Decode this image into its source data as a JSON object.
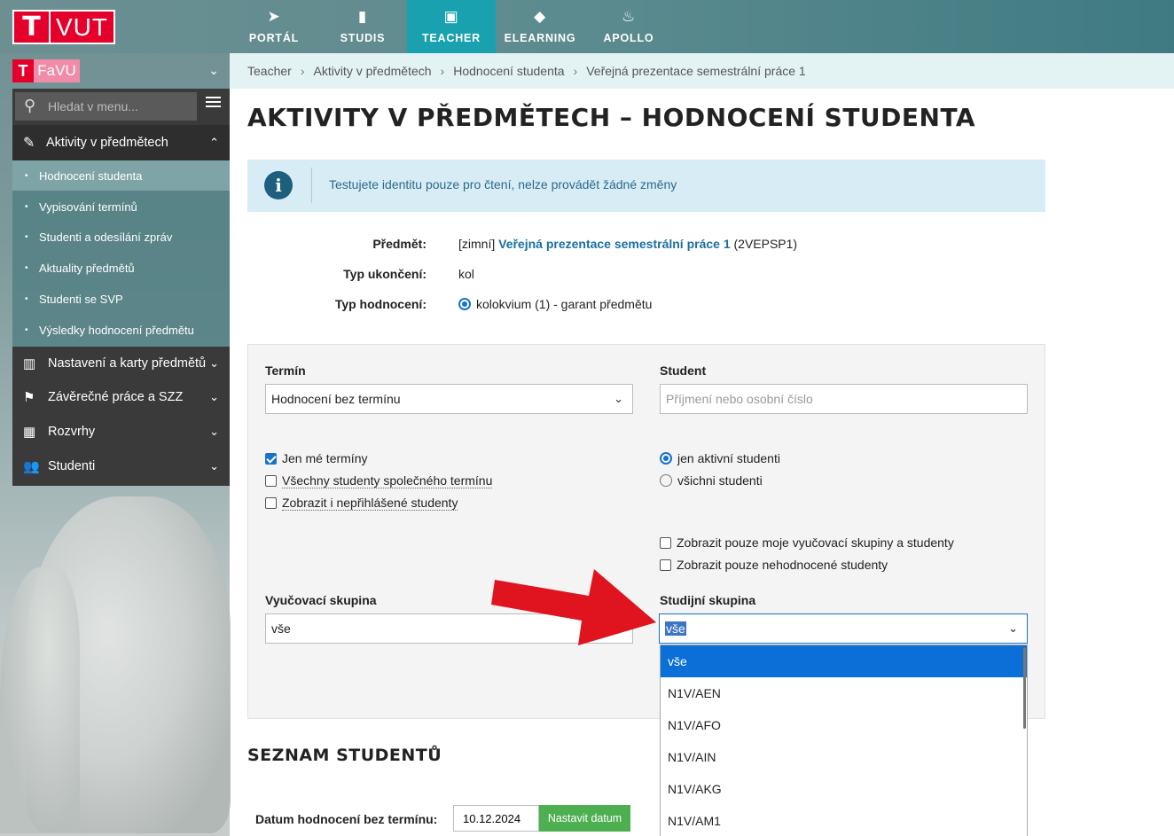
{
  "header": {
    "logo_letter": "T",
    "logo_text": "VUT",
    "nav": [
      {
        "label": "PORTÁL",
        "icon": "paper-plane-icon"
      },
      {
        "label": "STUDIS",
        "icon": "book-icon"
      },
      {
        "label": "TEACHER",
        "icon": "briefcase-icon",
        "active": true
      },
      {
        "label": "ELEARNING",
        "icon": "graduation-cap-icon"
      },
      {
        "label": "APOLLO",
        "icon": "flame-icon"
      }
    ]
  },
  "sidebar": {
    "faculty_letter": "T",
    "faculty_name": "FaVU",
    "search_placeholder": "Hledat v menu...",
    "open_section": "Aktivity v předmětech",
    "sub_items": [
      "Hodnocení studenta",
      "Vypisování termínů",
      "Studenti a odesílání zpráv",
      "Aktuality předmětů",
      "Studenti se SVP",
      "Výsledky hodnocení předmětu"
    ],
    "sections": [
      "Nastavení a karty předmětů",
      "Závěrečné práce a SZZ",
      "Rozvrhy",
      "Studenti"
    ]
  },
  "breadcrumb": [
    "Teacher",
    "Aktivity v předmětech",
    "Hodnocení studenta",
    "Veřejná prezentace semestrální práce 1"
  ],
  "page_title": "AKTIVITY V PŘEDMĚTECH – HODNOCENÍ STUDENTA",
  "info_text": "Testujete identitu pouze pro čtení, nelze provádět žádné změny",
  "meta": {
    "subject_label": "Předmět:",
    "subject_prefix": "[zimní]",
    "subject_name": "Veřejná prezentace semestrální práce 1",
    "subject_code": "(2VEPSP1)",
    "completion_label": "Typ ukončení:",
    "completion_value": "kol",
    "grading_label": "Typ hodnocení:",
    "grading_value": "kolokvium (1) - garant předmětu"
  },
  "filters": {
    "term_label": "Termín",
    "term_value": "Hodnocení bez termínu",
    "student_label": "Student",
    "student_placeholder": "Příjmení nebo osobní číslo",
    "checkboxes_left": [
      {
        "label": "Jen mé termíny",
        "checked": true
      },
      {
        "label": "Všechny studenty společného termínu",
        "checked": false
      },
      {
        "label": "Zobrazit i nepřihlášené studenty",
        "checked": false
      }
    ],
    "radios_right": [
      {
        "label": "jen aktivní studenti",
        "selected": true
      },
      {
        "label": "všichni studenti",
        "selected": false
      }
    ],
    "checkboxes_right": [
      {
        "label": "Zobrazit pouze moje vyučovací skupiny a studenty",
        "checked": false
      },
      {
        "label": "Zobrazit pouze nehodnocené studenty",
        "checked": false
      }
    ],
    "teaching_group_label": "Vyučovací skupina",
    "teaching_group_value": "vše",
    "study_group_label": "Studijní skupina",
    "study_group_value": "vše",
    "study_group_options": [
      "vše",
      "N1V/AEN",
      "N1V/AFO",
      "N1V/AIN",
      "N1V/AKG",
      "N1V/AM1"
    ]
  },
  "students": {
    "section_title": "SEZNAM STUDENTŮ",
    "date_label": "Datum hodnocení bez termínu:",
    "date_value": "10.12.2024",
    "set_date_button": "Nastavit datum"
  },
  "colors": {
    "accent": "#1aa1b0",
    "vut_red": "#e4002b",
    "link": "#1a6fa0",
    "selected_option": "#0a6fd6",
    "button_green": "#4caf50",
    "arrow_red": "#e0141e"
  }
}
